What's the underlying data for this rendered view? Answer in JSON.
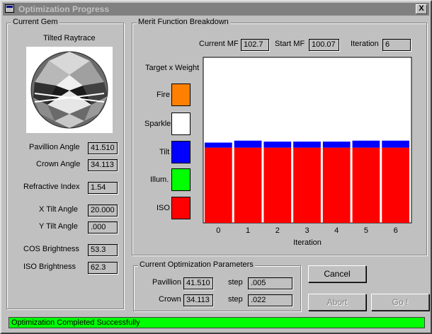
{
  "window": {
    "title": "Optimization Progress",
    "close_glyph": "X"
  },
  "current_gem": {
    "group_label": "Current Gem",
    "image_caption": "Tilted Raytrace",
    "fields": [
      {
        "label": "Pavillion Angle",
        "value": "41.510"
      },
      {
        "label": "Crown Angle",
        "value": "34.113"
      },
      {
        "label": "Refractive Index",
        "value": "1.54"
      },
      {
        "label": "X Tilt Angle",
        "value": "20.000"
      },
      {
        "label": "Y Tilt Angle",
        "value": ".000"
      },
      {
        "label": "COS Brightness",
        "value": "53.3"
      },
      {
        "label": "ISO Brightness",
        "value": "62.3"
      }
    ]
  },
  "merit": {
    "group_label": "Merit Function Breakdown",
    "current_mf_label": "Current MF",
    "current_mf": "102.7",
    "start_mf_label": "Start MF",
    "start_mf": "100.07",
    "iteration_label": "Iteration",
    "iteration": "6",
    "target_weight_label": "Target x Weight",
    "legend": [
      {
        "label": "Fire",
        "color": "#ff8000"
      },
      {
        "label": "Sparkle",
        "color": "#ffffff"
      },
      {
        "label": "Tilt",
        "color": "#0000ff"
      },
      {
        "label": "Illum.",
        "color": "#00ff00"
      },
      {
        "label": "ISO",
        "color": "#ff0000"
      }
    ]
  },
  "chart_data": {
    "type": "bar",
    "stacked": true,
    "xlabel": "Iteration",
    "categories": [
      "0",
      "1",
      "2",
      "3",
      "4",
      "5",
      "6"
    ],
    "series": [
      {
        "name": "ISO",
        "color": "#ff0000",
        "values": [
          100.0,
          100.0,
          100.0,
          100.0,
          100.0,
          100.0,
          100.0
        ]
      },
      {
        "name": "Tilt",
        "color": "#0000ff",
        "values": [
          6.7,
          9.3,
          8.0,
          8.0,
          8.0,
          9.3,
          9.3
        ]
      }
    ],
    "ylim": [
      0,
      220
    ],
    "grid": false
  },
  "params": {
    "group_label": "Current Optimization Parameters",
    "pavillion_label": "Pavillion",
    "pavillion_value": "41.510",
    "pavillion_step_label": "step",
    "pavillion_step": ".005",
    "crown_label": "Crown",
    "crown_value": "34.113",
    "crown_step_label": "step",
    "crown_step": ".022"
  },
  "buttons": {
    "cancel": "Cancel",
    "abort": "Abort",
    "go": "Go !"
  },
  "status": {
    "text": "Optimization Completed Successfully"
  }
}
